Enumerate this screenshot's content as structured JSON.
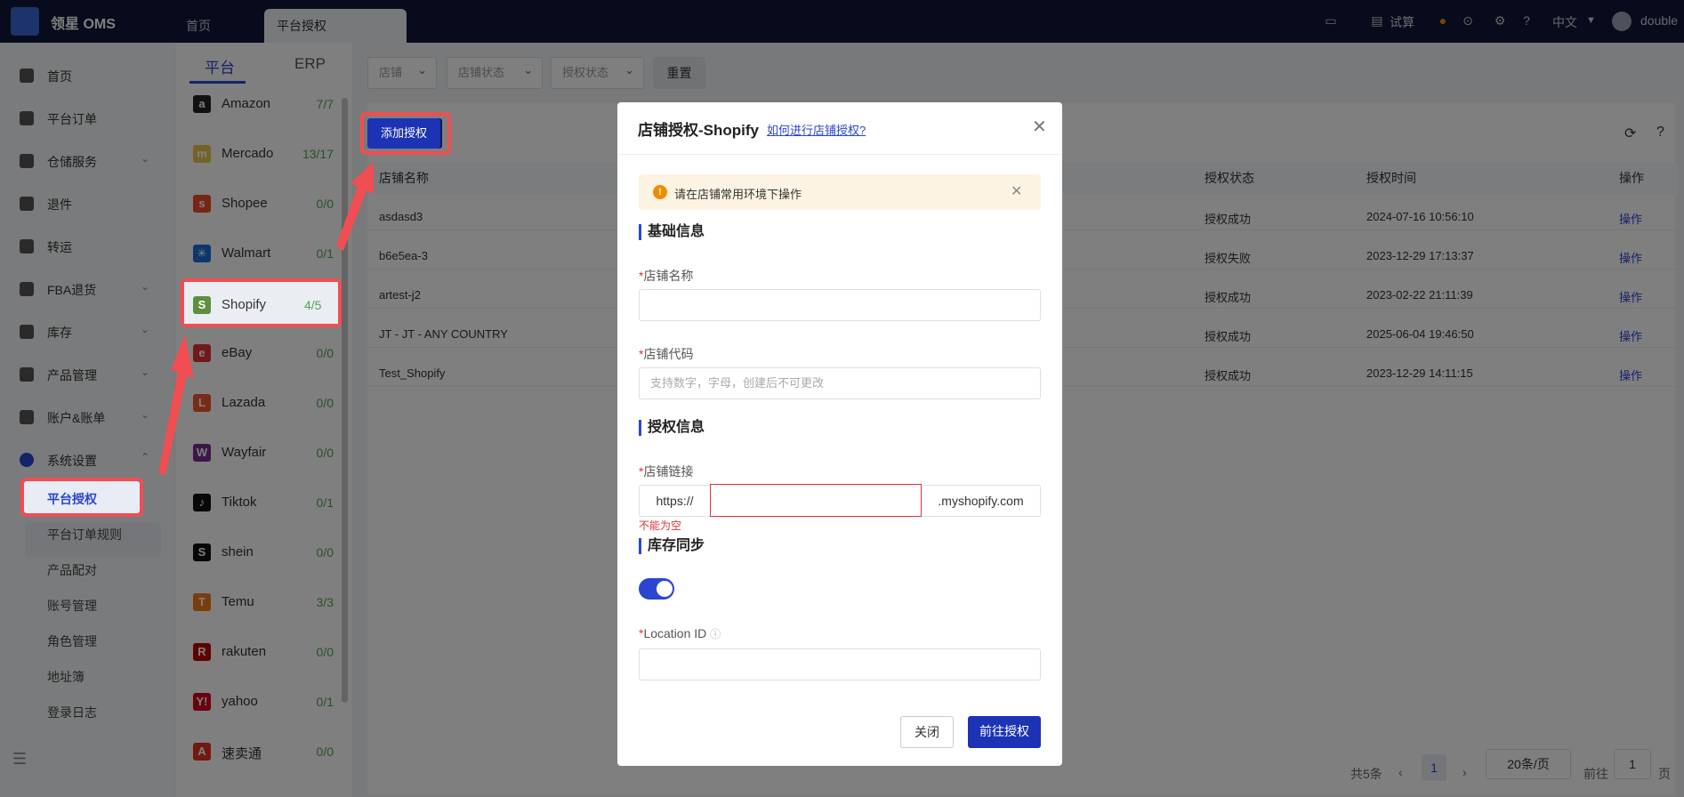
{
  "app": {
    "title": "领星 OMS",
    "user": "double"
  },
  "top_tabs": [
    {
      "label": "首页"
    },
    {
      "label": "平台授权"
    }
  ],
  "top_right": {
    "trial_label": "试算",
    "lang_label": "中文"
  },
  "sidebar": {
    "items": [
      {
        "label": "首页"
      },
      {
        "label": "平台订单"
      },
      {
        "label": "仓储服务"
      },
      {
        "label": "退件"
      },
      {
        "label": "转运"
      },
      {
        "label": "FBA退货"
      },
      {
        "label": "库存"
      },
      {
        "label": "产品管理"
      },
      {
        "label": "账户&账单"
      },
      {
        "label": "系统设置"
      }
    ],
    "sub_items": [
      {
        "label": "平台授权"
      },
      {
        "label": "平台订单规则"
      },
      {
        "label": "产品配对"
      },
      {
        "label": "账号管理"
      },
      {
        "label": "角色管理"
      },
      {
        "label": "地址簿"
      },
      {
        "label": "登录日志"
      }
    ]
  },
  "platform_tabs": [
    {
      "label": "平台"
    },
    {
      "label": "ERP"
    }
  ],
  "platforms": [
    {
      "name": "Amazon",
      "count": "7/7",
      "icon": "a",
      "color": "#222"
    },
    {
      "name": "Mercado",
      "count": "13/17",
      "icon": "m",
      "color": "#e6c84a"
    },
    {
      "name": "Shopee",
      "count": "0/0",
      "icon": "s",
      "color": "#ee4d2d"
    },
    {
      "name": "Walmart",
      "count": "0/1",
      "icon": "✳",
      "color": "#1a6ed8"
    },
    {
      "name": "Shopify",
      "count": "4/5",
      "icon": "S",
      "color": "#5e8e3e"
    },
    {
      "name": "eBay",
      "count": "0/0",
      "icon": "e",
      "color": "#e53238"
    },
    {
      "name": "Lazada",
      "count": "0/0",
      "icon": "L",
      "color": "#f0562a"
    },
    {
      "name": "Wayfair",
      "count": "0/0",
      "icon": "W",
      "color": "#7b2d8e"
    },
    {
      "name": "Tiktok",
      "count": "0/1",
      "icon": "♪",
      "color": "#111"
    },
    {
      "name": "shein",
      "count": "0/0",
      "icon": "S",
      "color": "#111"
    },
    {
      "name": "Temu",
      "count": "3/3",
      "icon": "T",
      "color": "#f07a1a"
    },
    {
      "name": "rakuten",
      "count": "0/0",
      "icon": "R",
      "color": "#bf0000"
    },
    {
      "name": "yahoo",
      "count": "0/1",
      "icon": "Y!",
      "color": "#d6001c"
    },
    {
      "name": "速卖通",
      "count": "0/0",
      "icon": "A",
      "color": "#e43225"
    }
  ],
  "filters": [
    {
      "label": "店铺"
    },
    {
      "label": "店铺状态"
    },
    {
      "label": "授权状态"
    }
  ],
  "reset_label": "重置",
  "add_auth_label": "添加授权",
  "table": {
    "headers": [
      "店铺名称",
      "授权状态",
      "授权时间",
      "操作"
    ],
    "rows": [
      {
        "name": "asdasd3",
        "status": "授权成功",
        "time": "2024-07-16 10:56:10",
        "op": "操作"
      },
      {
        "name": "b6e5ea-3",
        "status": "授权失败",
        "time": "2023-12-29 17:13:37",
        "op": "操作"
      },
      {
        "name": "artest-j2",
        "status": "授权成功",
        "time": "2023-02-22 21:11:39",
        "op": "操作"
      },
      {
        "name": "JT - JT - ANY COUNTRY",
        "status": "授权成功",
        "time": "2025-06-04 19:46:50",
        "op": "操作"
      },
      {
        "name": "Test_Shopify",
        "status": "授权成功",
        "time": "2023-12-29 14:11:15",
        "op": "操作"
      }
    ]
  },
  "pager": {
    "total": "共5条",
    "page": "1",
    "size": "20条/页",
    "goto": "前往",
    "goto_value": "1",
    "page_suffix": "页"
  },
  "modal": {
    "title": "店铺授权-Shopify",
    "help_link": "如何进行店铺授权?",
    "alert": "请在店铺常用环境下操作",
    "section_basic": "基础信息",
    "store_name_label": "店铺名称",
    "store_code_label": "店铺代码",
    "store_code_placeholder": "支持数字，字母，创建后不可更改",
    "section_auth": "授权信息",
    "store_link_label": "店铺链接",
    "link_prefix": "https://",
    "link_suffix": ".myshopify.com",
    "link_error": "不能为空",
    "section_inventory": "库存同步",
    "inventory_sync": true,
    "location_label": "Location ID",
    "close_label": "关闭",
    "submit_label": "前往授权"
  },
  "colors": {
    "accent": "#2a46d1",
    "annotation_red": "#f04e52",
    "topbar": "#0f1737"
  }
}
